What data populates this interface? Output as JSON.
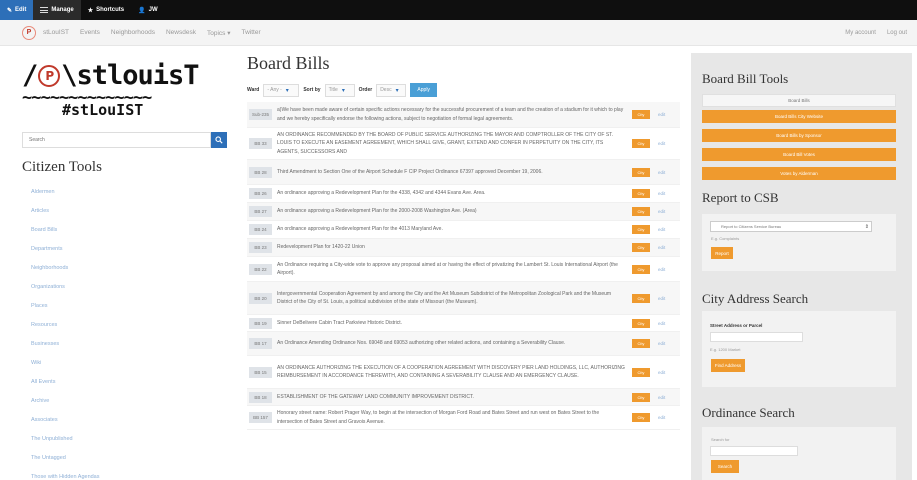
{
  "admin_bar": {
    "edit": "Edit",
    "manage": "Manage",
    "shortcuts": "Shortcuts",
    "user": "JW"
  },
  "nav": {
    "site_name": "stLouIST",
    "links": [
      "Events",
      "Neighborhoods",
      "Newsdesk",
      "Topics ▾",
      "Twitter"
    ],
    "my_account": "My account",
    "log_out": "Log out"
  },
  "logo": {
    "line1_prefix": "/",
    "line1_circle": "P",
    "line1_suffix": "\\stlouisT",
    "line2": "~~~~~~~~~~~~~~",
    "line3": "#stLouIST"
  },
  "search": {
    "placeholder": "Search"
  },
  "citizen_tools": {
    "title": "Citizen Tools",
    "items": [
      "Aldermen",
      "Articles",
      "Board Bills",
      "Departments",
      "Neighborhoods",
      "Organizations",
      "Places",
      "Resources",
      "Businesses",
      "Wiki",
      "All Events",
      "Archive",
      "Associates",
      "The Unpublished",
      "The Untagged",
      "Those with Hidden Agendas"
    ]
  },
  "main": {
    "title": "Board Bills",
    "filters": {
      "ward_label": "Ward",
      "ward_value": "- Any -",
      "sort_label": "Sort by",
      "sort_value": "Title",
      "order_label": "Order",
      "order_value": "Desc",
      "apply": "Apply"
    },
    "bills": [
      {
        "id": "Sub-235",
        "text": "a)We have been made aware of certain specific actions necessary for the successful procurement of a team and the creation of a stadium for it which to play and we hereby specifically endorse the following actions, subject to negotiation of formal legal agreements."
      },
      {
        "id": "BB 33",
        "text": "AN ORDINANCE RECOMMENDED BY THE BOARD OF PUBLIC SERVICE AUTHORIZING THE MAYOR AND COMPTROLLER OF THE CITY OF ST. LOUIS TO EXECUTE AN EASEMENT AGREEMENT, WHICH SHALL GIVE, GRANT, EXTEND AND CONFER IN PERPETUITY ON THE CITY, ITS AGENTS, SUCCESSORS AND"
      },
      {
        "id": "BB 28",
        "text": "Third Amendment to Section One of the Airport Schedule F CIP Project Ordinance 67397 approved December 19, 2006."
      },
      {
        "id": "BB 26",
        "text": "An ordinance approving a Redevelopment Plan for the 4338, 4342 and 4344 Evans Ave. Area."
      },
      {
        "id": "BB 27",
        "text": "An ordinance approving a Redevelopment Plan for the 2000-2008 Washington Ave. (Area)"
      },
      {
        "id": "BB 24",
        "text": "An ordinance approving a Redevelopment Plan for the 4013 Maryland Ave."
      },
      {
        "id": "BB 23",
        "text": "Redevelopment Plan for 1420-22 Union"
      },
      {
        "id": "BB 22",
        "text": "An Ordinance requiring a City-wide vote to approve any proposal aimed at or having the effect of privatizing the Lambert St. Louis International Airport (the Airport)."
      },
      {
        "id": "BB 20",
        "text": "Intergovernmental Cooperation Agreement by and among the City and the Art Museum Subdistrict of the Metropolitan Zoological Park and the Museum District of the City of St. Louis, a political subdivision of the state of Missouri (the Museum)."
      },
      {
        "id": "BB 19",
        "text": "Sinner DeBelivere Cabin Tract Parkview Historic District."
      },
      {
        "id": "BB 17",
        "text": "An Ordinance Amending Ordinance Nos. 69048 and 69053 authorizing other related actions, and containing a Severability Clause."
      },
      {
        "id": "BB 15",
        "text": "AN ORDINANCE AUTHORIZING THE EXECUTION OF A COOPERATION AGREEMENT WITH DISCOVERY PIER LAND HOLDINGS, LLC, AUTHORIZING REIMBURSEMENT IN ACCORDANCE THEREWITH, AND CONTAINING A SEVERABILITY CLAUSE AND AN EMERGENCY CLAUSE."
      },
      {
        "id": "BB 18",
        "text": "ESTABLISHMENT OF THE GATEWAY LAND COMMUNITY IMPROVEMENT DISTRICT."
      },
      {
        "id": "BB 157",
        "text": "Honorary street name: Robert Prager Way, to begin at the intersection of Morgan Ford Road and Bates Street and run west on Bates Street to the intersection of Bates Street and Gravois Avenue."
      }
    ],
    "bill_button": "City",
    "bill_edit": "edit"
  },
  "board_bill_tools": {
    "title": "Board Bill Tools",
    "buttons": [
      "Board Bills",
      "Board Bills City Website",
      "Board Bills by Sponsor",
      "Board Bill Votes",
      "Votes by Alderman"
    ]
  },
  "report_csb": {
    "title": "Report to CSB",
    "select_value": "Report to Citizens Service Bureau",
    "hint": "E.g. Complaints",
    "button": "Report"
  },
  "address_search": {
    "title": "City Address Search",
    "label": "Street Address or Parcel",
    "hint": "E.g. 1200 Market",
    "button": "Find Address"
  },
  "ordinance_search": {
    "title": "Ordinance Search",
    "label": "Search for",
    "button": "Search"
  }
}
